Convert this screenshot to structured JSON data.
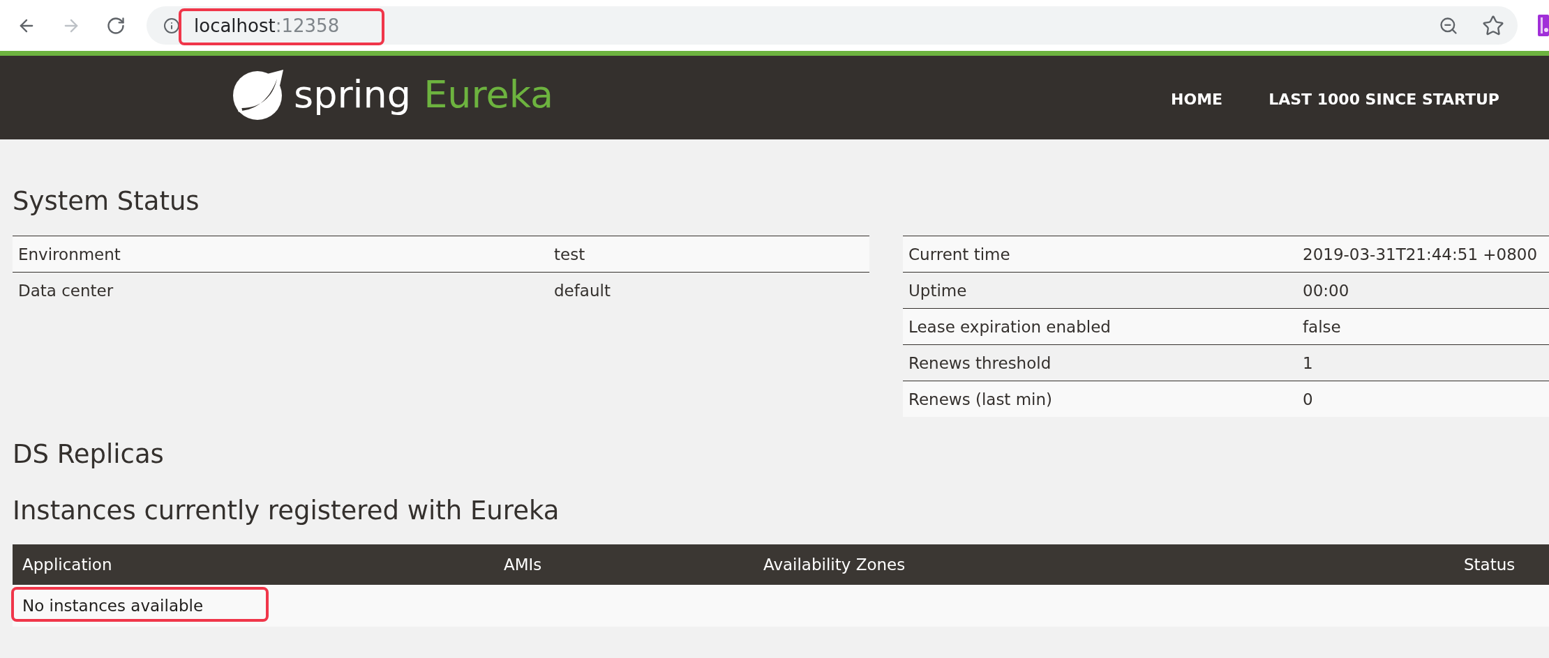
{
  "browser": {
    "nav_buttons": [
      {
        "kind": "back",
        "disabled": false
      },
      {
        "kind": "forward",
        "disabled": true
      },
      {
        "kind": "reload",
        "disabled": false
      }
    ],
    "address_bar": {
      "host": "localhost",
      "port": ":12358",
      "highlighted": true
    }
  },
  "header": {
    "logo": {
      "wordmark": "spring",
      "product": "Eureka"
    },
    "nav": [
      {
        "label": "HOME"
      },
      {
        "label": "LAST 1000 SINCE STARTUP"
      }
    ]
  },
  "system_status": {
    "title": "System Status",
    "general": [
      {
        "label": "Environment",
        "value": "test"
      },
      {
        "label": "Data center",
        "value": "default"
      }
    ],
    "stats": [
      {
        "label": "Current time",
        "value": "2019-03-31T21:44:51 +0800"
      },
      {
        "label": "Uptime",
        "value": "00:00"
      },
      {
        "label": "Lease expiration enabled",
        "value": "false"
      },
      {
        "label": "Renews threshold",
        "value": "1"
      },
      {
        "label": "Renews (last min)",
        "value": "0"
      }
    ]
  },
  "ds_replicas": {
    "title": "DS Replicas"
  },
  "instances": {
    "title": "Instances currently registered with Eureka",
    "columns": [
      "Application",
      "AMIs",
      "Availability Zones",
      "Status"
    ],
    "empty_message": "No instances available",
    "empty_highlighted": true
  }
}
